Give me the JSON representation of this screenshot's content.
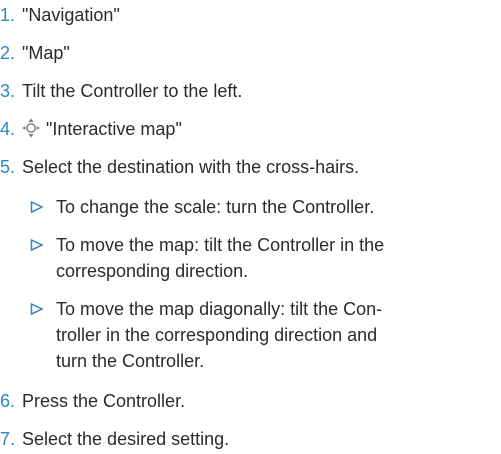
{
  "steps": [
    {
      "number": "1.",
      "text": "\"Navigation\""
    },
    {
      "number": "2.",
      "text": "\"Map\""
    },
    {
      "number": "3.",
      "text": "Tilt the Controller to the left."
    },
    {
      "number": "4.",
      "text": "\"Interactive map\"",
      "icon": "controller-icon"
    },
    {
      "number": "5.",
      "text": "Select the destination with the cross-hairs."
    },
    {
      "number": "6.",
      "text": "Press the Controller."
    },
    {
      "number": "7.",
      "text": "Select the desired setting."
    }
  ],
  "substeps": [
    {
      "lines": [
        "To change the scale: turn the Controller."
      ]
    },
    {
      "lines": [
        "To move the map: tilt the Controller in the",
        "corresponding direction."
      ]
    },
    {
      "lines": [
        "To move the map diagonally: tilt the Con-",
        "troller in the corresponding direction and",
        "turn the Controller."
      ]
    }
  ],
  "colors": {
    "accent": "#2f86c6",
    "text": "#2b2b2b"
  }
}
